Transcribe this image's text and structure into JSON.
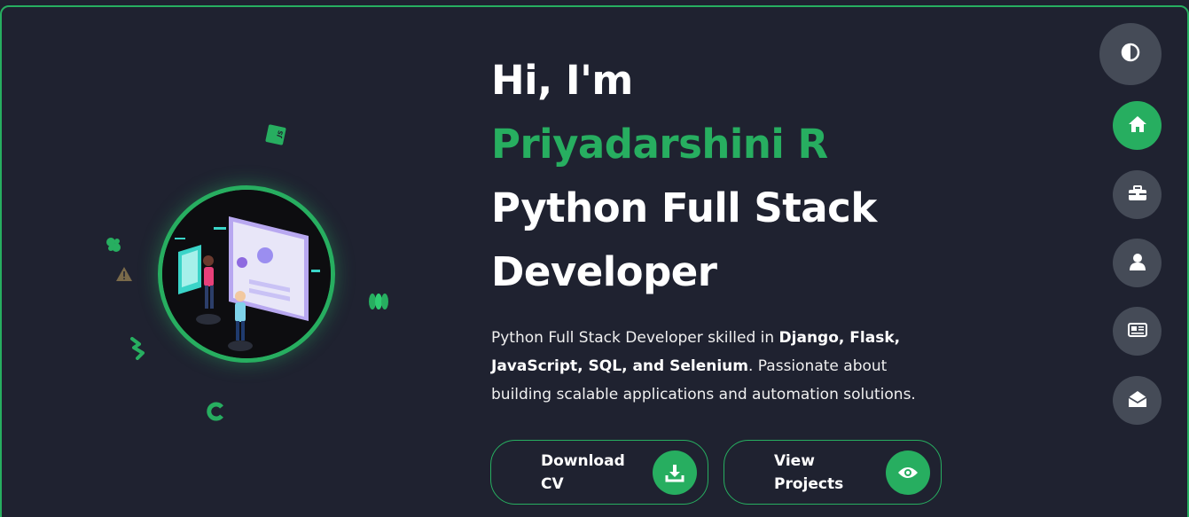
{
  "hero": {
    "greeting": "Hi, I'm",
    "name": "Priyadarshini R",
    "role_line1": "Python Full Stack",
    "role_line2": "Developer",
    "intro": {
      "part1": "Python Full Stack Developer skilled in ",
      "bold1": "Django, Flask,",
      "bold2": "JavaScript, SQL, and Selenium",
      "part2": ". Passionate about",
      "part3": "building scalable applications and automation solutions."
    }
  },
  "buttons": {
    "download_cv": "Download CV",
    "view_projects": "View Projects"
  },
  "nav": {
    "items": [
      "home",
      "work",
      "about",
      "resume",
      "contact"
    ],
    "active": "home"
  },
  "colors": {
    "accent": "#27ae60",
    "background": "#1f2230",
    "nav_idle": "#454b57"
  },
  "icons": {
    "floating": [
      "javascript-icon",
      "python-icon",
      "warning-icon",
      "swift-icon",
      "c-icon",
      "coins-icon"
    ],
    "js_badge": "JS"
  }
}
